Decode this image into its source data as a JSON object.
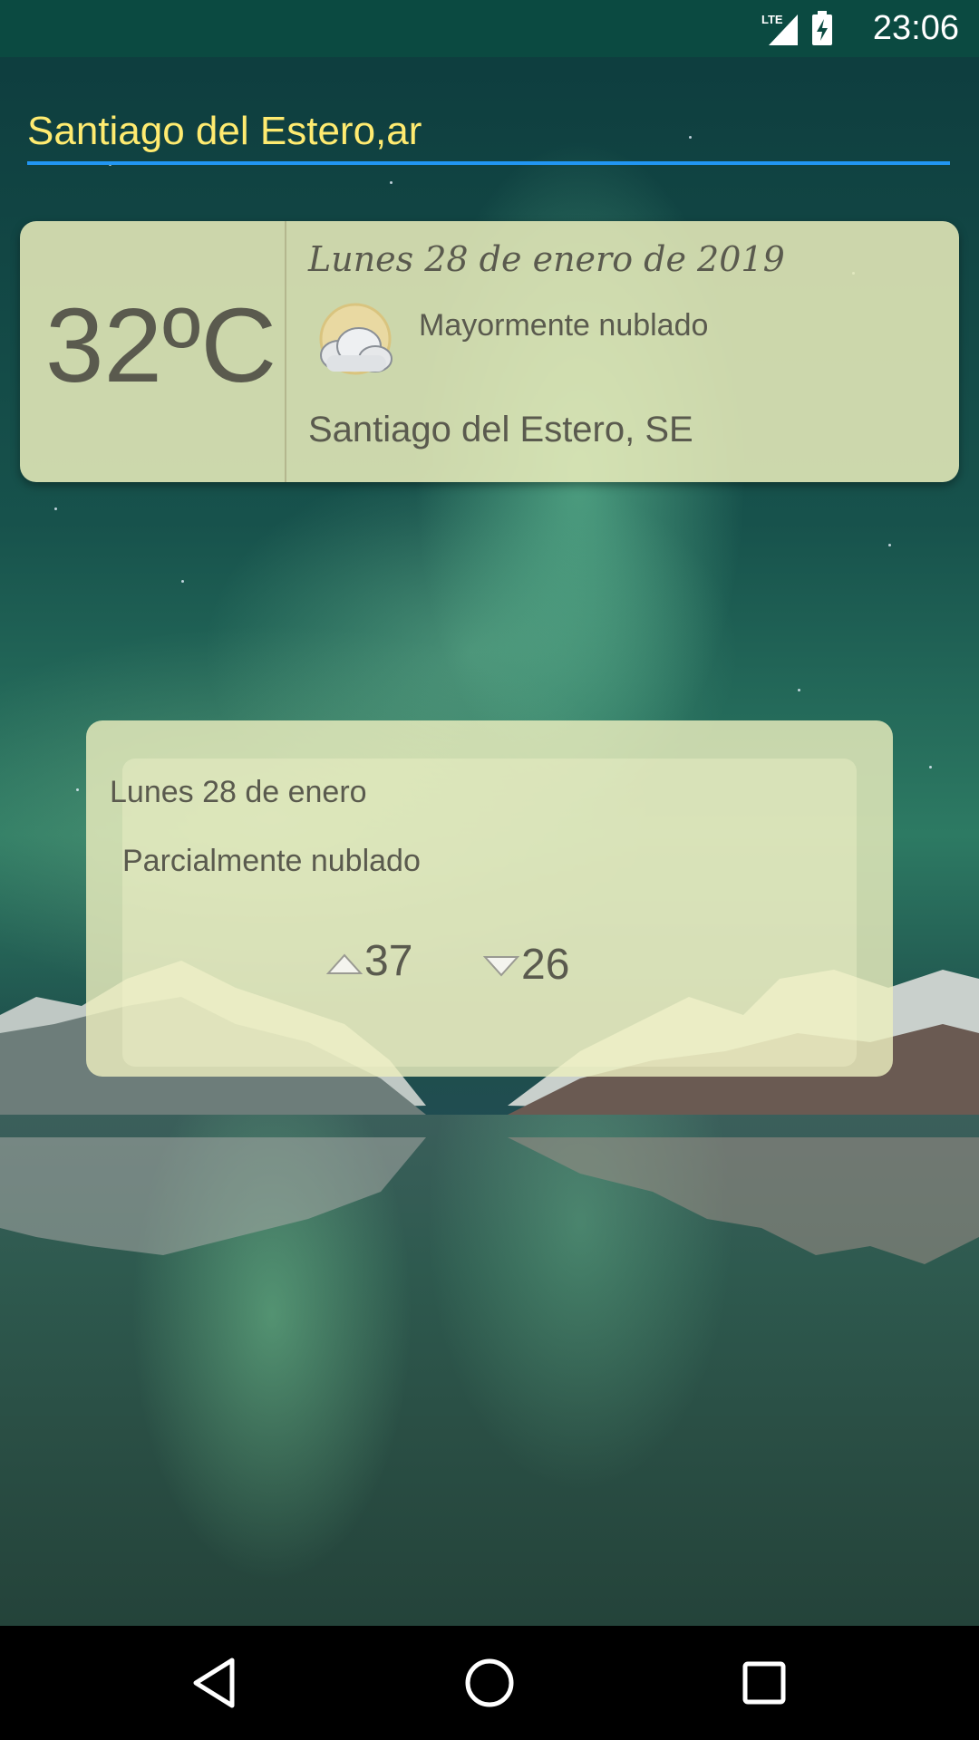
{
  "status_bar": {
    "time": "23:06",
    "network": "LTE",
    "icons": [
      "lte-signal-icon",
      "battery-charging-icon"
    ]
  },
  "city_input": {
    "value": "Santiago del Estero,ar"
  },
  "current": {
    "temperature": "32ºC",
    "date": "Lunes 28 de enero de 2019",
    "description": "Mayormente nublado",
    "location": "Santiago del Estero,  SE",
    "icon": "partly-cloudy-icon"
  },
  "forecast": {
    "date": "Lunes 28 de enero",
    "description": "Parcialmente nublado",
    "high": "37",
    "low": "26"
  },
  "nav": {
    "icons": [
      "back-icon",
      "home-icon",
      "recents-icon"
    ]
  },
  "colors": {
    "status_bar": "#0b4a41",
    "input_text": "#ffeb70",
    "input_underline": "#2196f3",
    "card_text": "#5a5a4e"
  }
}
